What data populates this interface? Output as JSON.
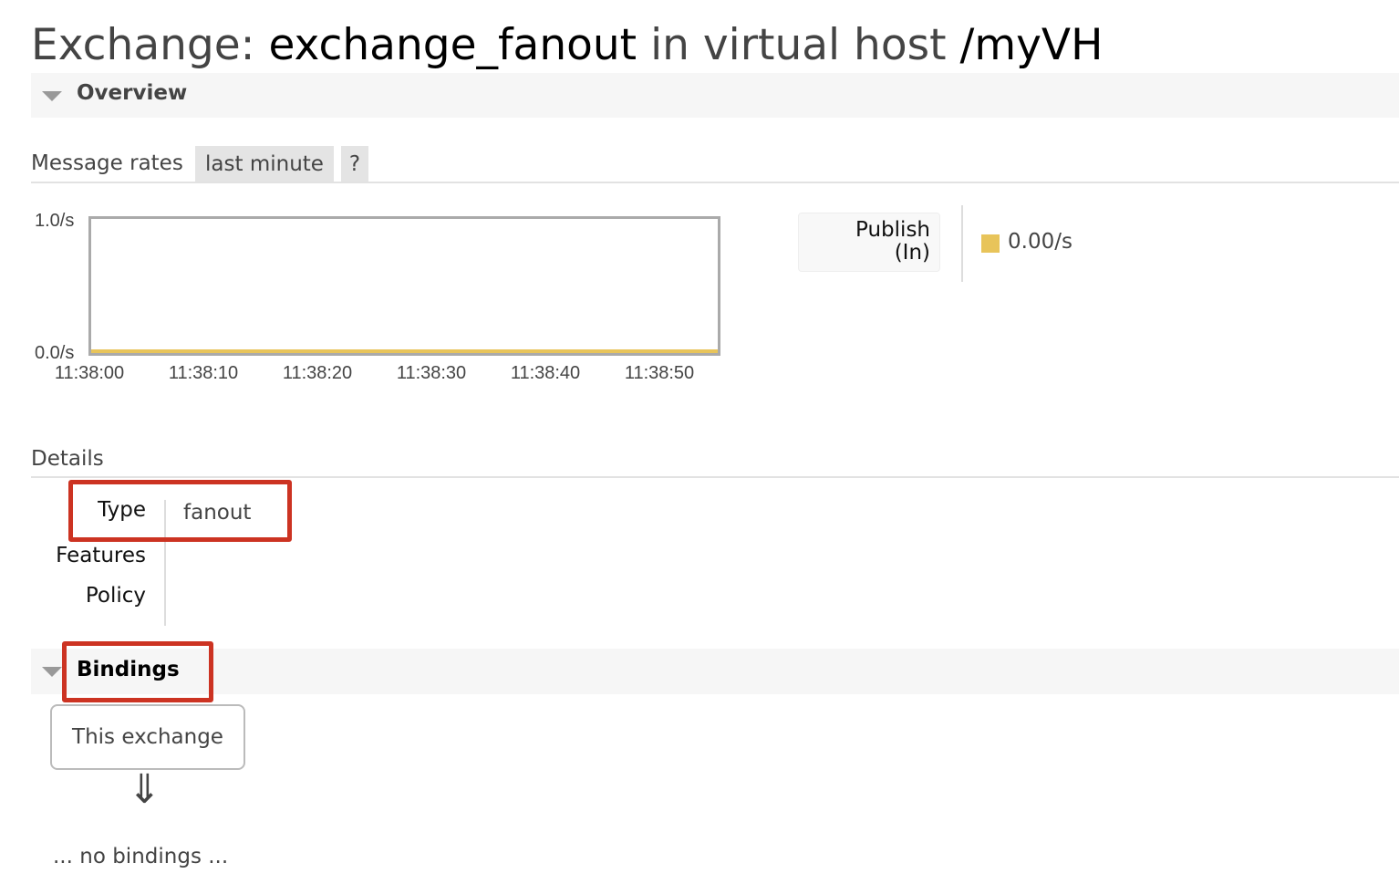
{
  "title": {
    "prefix": "Exchange:",
    "exchange": "exchange_fanout",
    "middle": "in virtual host",
    "vhost": "/myVH"
  },
  "overview": {
    "label": "Overview"
  },
  "message_rates": {
    "label": "Message rates",
    "range": "last minute",
    "help": "?"
  },
  "chart_data": {
    "type": "line",
    "x": [
      "11:38:00",
      "11:38:10",
      "11:38:20",
      "11:38:30",
      "11:38:40",
      "11:38:50"
    ],
    "series": [
      {
        "name": "Publish (In)",
        "values": [
          0,
          0,
          0,
          0,
          0,
          0
        ],
        "color": "#e8c45a"
      }
    ],
    "ylim": [
      0,
      1.0
    ],
    "yticks": [
      "1.0/s",
      "0.0/s"
    ],
    "xticks": [
      "11:38:00",
      "11:38:10",
      "11:38:20",
      "11:38:30",
      "11:38:40",
      "11:38:50"
    ]
  },
  "legend": {
    "label_line1": "Publish",
    "label_line2": "(In)",
    "value": "0.00/s",
    "color": "#e8c45a"
  },
  "details": {
    "label": "Details",
    "rows": [
      {
        "key": "Type",
        "value": "fanout"
      },
      {
        "key": "Features",
        "value": ""
      },
      {
        "key": "Policy",
        "value": ""
      }
    ]
  },
  "bindings": {
    "label": "Bindings",
    "this_exchange": "This exchange",
    "arrow": "⇓",
    "empty": "... no bindings ..."
  },
  "highlight_color": "#cc3322"
}
